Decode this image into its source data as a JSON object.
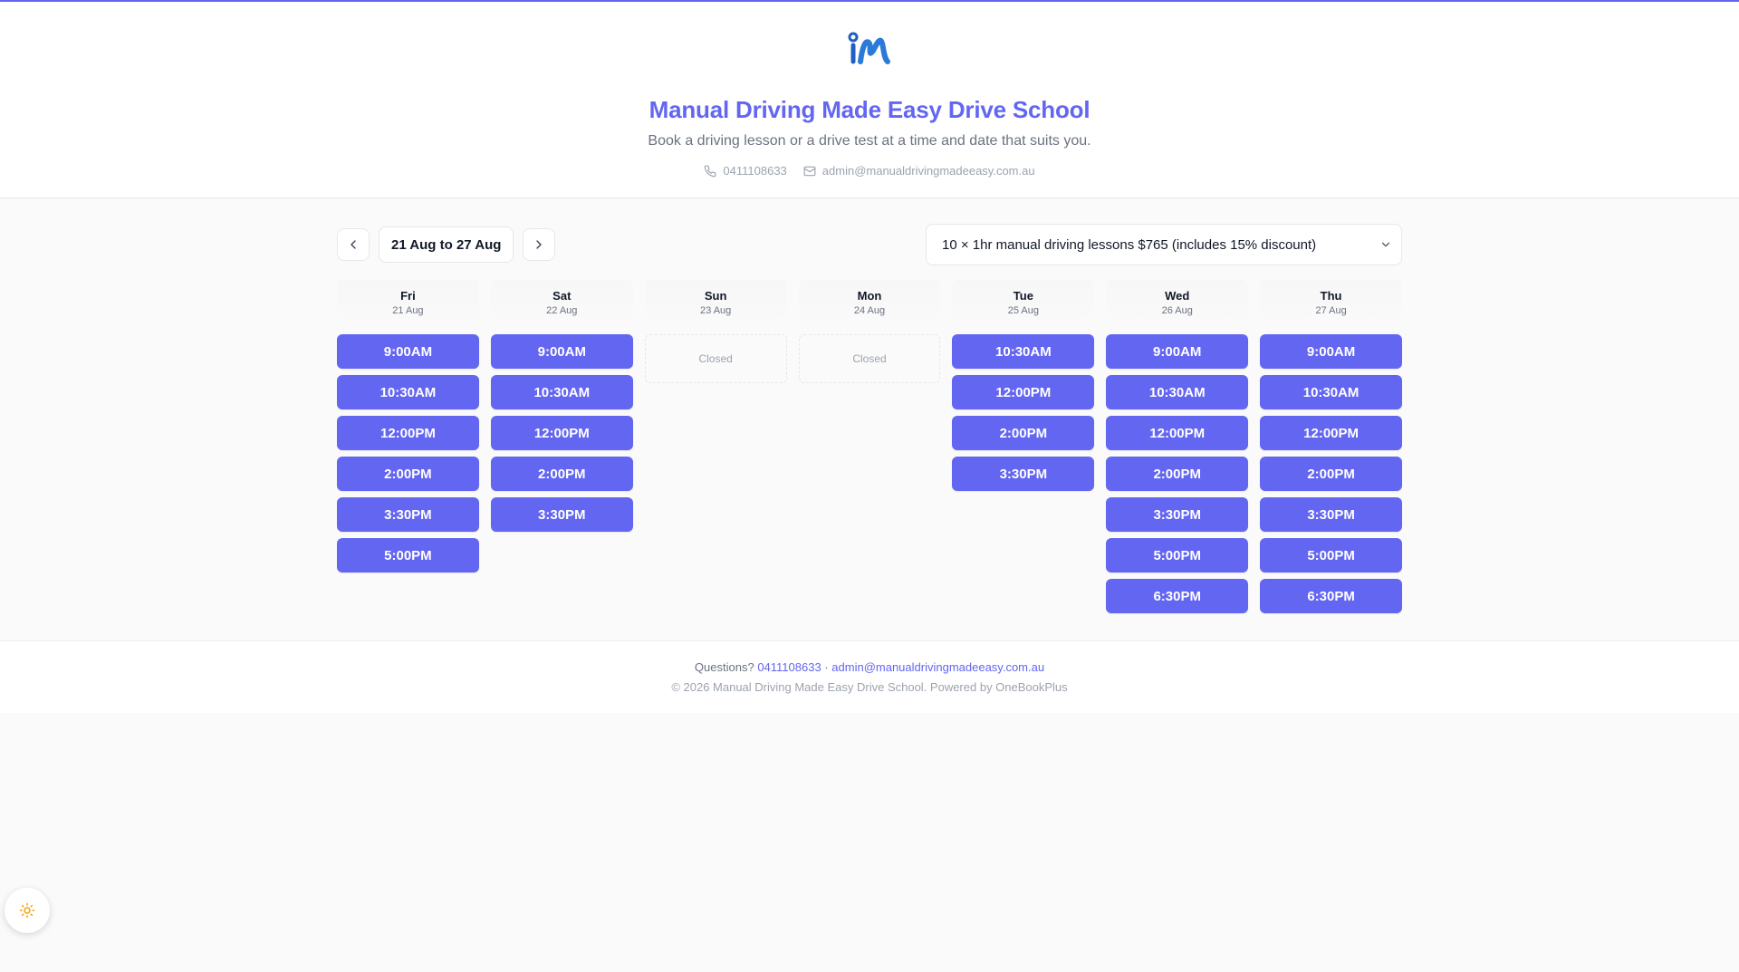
{
  "header": {
    "school_name": "Manual Driving Made Easy Drive School",
    "tagline": "Book a driving lesson or a drive test at a time and date that suits you.",
    "phone": "0411108633",
    "email": "admin@manualdrivingmadeeasy.com.au"
  },
  "toolbar": {
    "prev_icon": "chevron-left-icon",
    "next_icon": "chevron-right-icon",
    "date_range": "21 Aug to 27 Aug",
    "service_selected": "10 × 1hr manual driving lessons $765 (includes 15% discount)"
  },
  "days": [
    {
      "name": "Fri",
      "date": "21 Aug",
      "closed": false,
      "slots": [
        "9:00AM",
        "10:30AM",
        "12:00PM",
        "2:00PM",
        "3:30PM",
        "5:00PM"
      ]
    },
    {
      "name": "Sat",
      "date": "22 Aug",
      "closed": false,
      "slots": [
        "9:00AM",
        "10:30AM",
        "12:00PM",
        "2:00PM",
        "3:30PM"
      ]
    },
    {
      "name": "Sun",
      "date": "23 Aug",
      "closed": true,
      "closed_label": "Closed",
      "slots": []
    },
    {
      "name": "Mon",
      "date": "24 Aug",
      "closed": true,
      "closed_label": "Closed",
      "slots": []
    },
    {
      "name": "Tue",
      "date": "25 Aug",
      "closed": false,
      "slots": [
        "10:30AM",
        "12:00PM",
        "2:00PM",
        "3:30PM"
      ]
    },
    {
      "name": "Wed",
      "date": "26 Aug",
      "closed": false,
      "slots": [
        "9:00AM",
        "10:30AM",
        "12:00PM",
        "2:00PM",
        "3:30PM",
        "5:00PM",
        "6:30PM"
      ]
    },
    {
      "name": "Thu",
      "date": "27 Aug",
      "closed": false,
      "slots": [
        "9:00AM",
        "10:30AM",
        "12:00PM",
        "2:00PM",
        "3:30PM",
        "5:00PM",
        "6:30PM"
      ]
    }
  ],
  "footer": {
    "questions_label": "Questions?",
    "separator": "·",
    "phone": "0411108633",
    "email": "admin@manualdrivingmadeeasy.com.au",
    "copyright": "© 2026 Manual Driving Made Easy Drive School. Powered by OneBookPlus"
  },
  "colors": {
    "accent": "#6366f1",
    "text": "#111827",
    "muted": "#6b7280"
  }
}
